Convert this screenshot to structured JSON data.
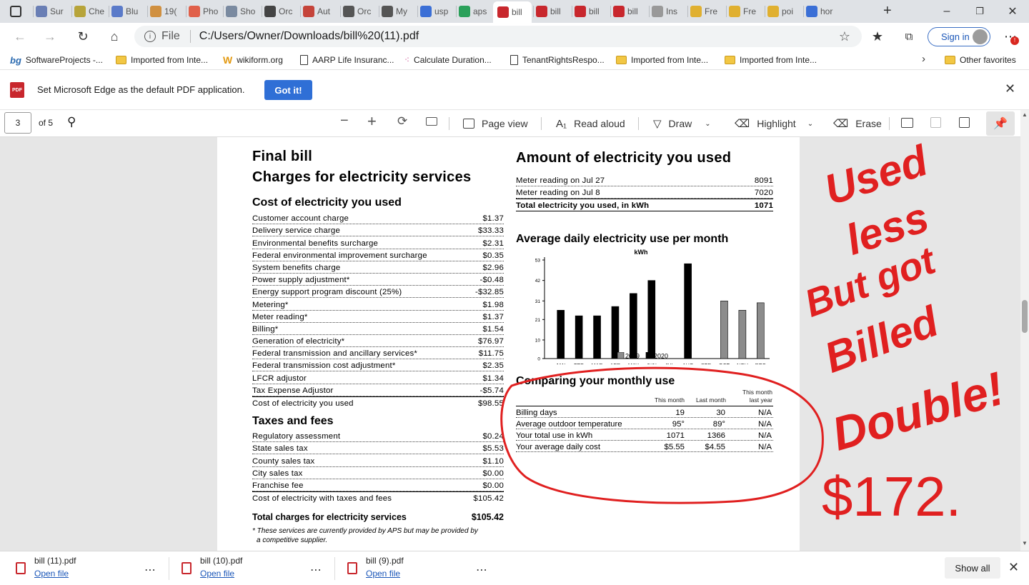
{
  "tabs": [
    {
      "label": "Sur",
      "color": "#6a7fb5"
    },
    {
      "label": "Che",
      "color": "#b7a43a"
    },
    {
      "label": "Blu",
      "color": "#5a7ac9"
    },
    {
      "label": "19(",
      "color": "#d09040"
    },
    {
      "label": "Pho",
      "color": "#e0604a"
    },
    {
      "label": "Sho",
      "color": "#7a8aa0"
    },
    {
      "label": "Orc",
      "color": "#444444"
    },
    {
      "label": "Aut",
      "color": "#c5443a"
    },
    {
      "label": "Orc",
      "color": "#555555"
    },
    {
      "label": "My",
      "color": "#555555"
    },
    {
      "label": "usp",
      "color": "#3b6fd6"
    },
    {
      "label": "aps",
      "color": "#2aa05a"
    },
    {
      "label": "bill",
      "color": "#c8272d"
    },
    {
      "label": "bill",
      "color": "#c8272d"
    },
    {
      "label": "bill",
      "color": "#c8272d"
    },
    {
      "label": "bill",
      "color": "#c8272d"
    },
    {
      "label": "Ins",
      "color": "#999999"
    },
    {
      "label": "Fre",
      "color": "#e0b030"
    },
    {
      "label": "Fre",
      "color": "#e0b030"
    },
    {
      "label": "poi",
      "color": "#e0b030"
    },
    {
      "label": "hor",
      "color": "#3b6fd6"
    }
  ],
  "address": {
    "scheme": "File",
    "url": "C:/Users/Owner/Downloads/bill%20(11).pdf"
  },
  "signin_label": "Sign in",
  "favorites": [
    {
      "label": "SoftwareProjects -...",
      "icon": "bg-logo-icon"
    },
    {
      "label": "Imported from Inte...",
      "icon": "folder-icon"
    },
    {
      "label": "wikiform.org",
      "icon": "w-logo-icon"
    },
    {
      "label": "AARP Life Insuranc...",
      "icon": "page-icon"
    },
    {
      "label": "Calculate Duration...",
      "icon": "dots-icon"
    },
    {
      "label": "TenantRightsRespo...",
      "icon": "page-icon"
    },
    {
      "label": "Imported from Inte...",
      "icon": "folder-icon"
    },
    {
      "label": "Imported from Inte...",
      "icon": "folder-icon"
    }
  ],
  "other_favorites": "Other favorites",
  "infobar": {
    "message": "Set Microsoft Edge as the default PDF application.",
    "button": "Got it!"
  },
  "pdf_toolbar": {
    "page": "3",
    "of": "of 5",
    "page_view": "Page view",
    "read_aloud": "Read aloud",
    "draw": "Draw",
    "highlight": "Highlight",
    "erase": "Erase"
  },
  "bill": {
    "title1": "Final bill",
    "title2": "Charges for electricity services",
    "cost_heading": "Cost of electricity you used",
    "cost_rows": [
      {
        "label": "Customer account charge",
        "value": "$1.37"
      },
      {
        "label": "Delivery service charge",
        "value": "$33.33"
      },
      {
        "label": "Environmental benefits surcharge",
        "value": "$2.31"
      },
      {
        "label": "Federal environmental improvement surcharge",
        "value": "$0.35"
      },
      {
        "label": "System benefits charge",
        "value": "$2.96"
      },
      {
        "label": "Power supply adjustment*",
        "value": "-$0.48"
      },
      {
        "label": "Energy support program discount (25%)",
        "value": "-$32.85"
      },
      {
        "label": "Metering*",
        "value": "$1.98"
      },
      {
        "label": "Meter reading*",
        "value": "$1.37"
      },
      {
        "label": "Billing*",
        "value": "$1.54"
      },
      {
        "label": "Generation of electricity*",
        "value": "$76.97"
      },
      {
        "label": "Federal transmission and ancillary services*",
        "value": "$11.75"
      },
      {
        "label": "Federal transmission cost adjustment*",
        "value": "$2.35"
      },
      {
        "label": "LFCR adjustor",
        "value": "$1.34"
      },
      {
        "label": "Tax Expense Adjustor",
        "value": "-$5.74"
      }
    ],
    "cost_total": {
      "label": "Cost of electricity you used",
      "value": "$98.55"
    },
    "taxes_heading": "Taxes and fees",
    "tax_rows": [
      {
        "label": "Regulatory assessment",
        "value": "$0.24"
      },
      {
        "label": "State sales tax",
        "value": "$5.53"
      },
      {
        "label": "County sales tax",
        "value": "$1.10"
      },
      {
        "label": "City sales tax",
        "value": "$0.00"
      },
      {
        "label": "Franchise fee",
        "value": "$0.00"
      }
    ],
    "tax_total": {
      "label": "Cost of electricity with taxes and fees",
      "value": "$105.42"
    },
    "grand_total": {
      "label": "Total charges for electricity services",
      "value": "$105.42"
    },
    "footnote1": "* These services are currently provided by APS but may be provided by",
    "footnote2": "a competitive supplier.",
    "amount_heading": "Amount of electricity you used",
    "meter_rows": [
      {
        "label": "Meter reading on Jul 27",
        "value": "8091"
      },
      {
        "label": "Meter reading on Jul 8",
        "value": "7020"
      }
    ],
    "meter_total": {
      "label": "Total electricity you used, in kWh",
      "value": "1071"
    },
    "avg_heading": "Average daily electricity use per month",
    "compare_heading": "Comparing your monthly use",
    "compare_cols": [
      "This month",
      "Last month",
      "This month",
      "last year"
    ],
    "compare_rows": [
      {
        "label": "Billing days",
        "this": "19",
        "last": "30",
        "year": "N/A"
      },
      {
        "label": "Average outdoor temperature",
        "this": "95°",
        "last": "89°",
        "year": "N/A"
      },
      {
        "label": "Your total use in kWh",
        "this": "1071",
        "last": "1366",
        "year": "N/A"
      },
      {
        "label": "Your average daily cost",
        "this": "$5.55",
        "last": "$4.55",
        "year": "N/A"
      }
    ]
  },
  "chart_data": {
    "type": "bar",
    "title": "Average daily electricity use per month",
    "ylabel": "kWh",
    "categories": [
      "JAN",
      "FEB",
      "MAR",
      "APR",
      "MAY",
      "JUN",
      "JUL",
      "AUG",
      "SEP",
      "OCT",
      "NOV",
      "DEC"
    ],
    "yticks": [
      0,
      10,
      21,
      31,
      42,
      53
    ],
    "ylim": [
      0,
      53
    ],
    "series": [
      {
        "name": "2019",
        "color": "#8c8c8c",
        "values": [
          null,
          null,
          null,
          null,
          null,
          null,
          null,
          null,
          null,
          31,
          26,
          30
        ]
      },
      {
        "name": "2020",
        "color": "#000000",
        "values": [
          26,
          23,
          23,
          28,
          35,
          42,
          null,
          51,
          null,
          null,
          null,
          null
        ]
      }
    ],
    "legend": "bottom"
  },
  "annotation_handwriting": [
    "Used",
    "less",
    "But got",
    "Billed",
    "Double!",
    "$172."
  ],
  "downloads": [
    {
      "name": "bill (11).pdf",
      "link": "Open file"
    },
    {
      "name": "bill (10).pdf",
      "link": "Open file"
    },
    {
      "name": "bill (9).pdf",
      "link": "Open file"
    }
  ],
  "show_all": "Show all"
}
